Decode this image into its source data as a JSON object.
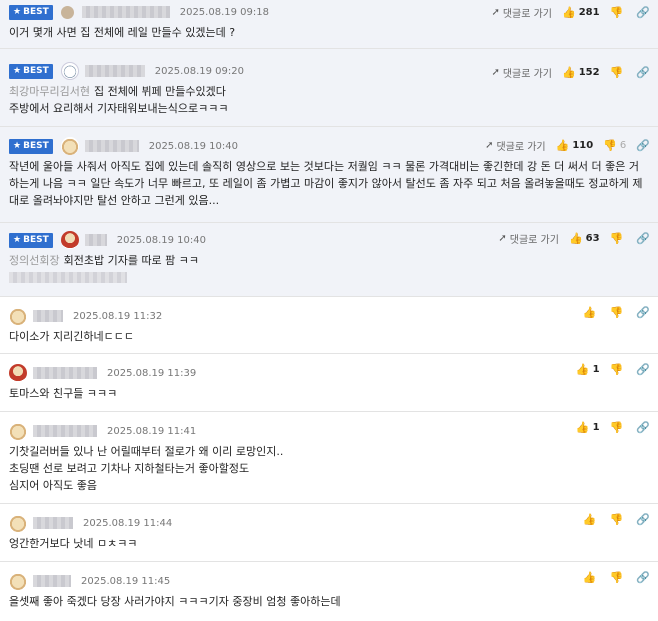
{
  "best_label": "BEST",
  "reply_label": "댓글로 가기",
  "comments": [
    {
      "date": "2025.08.19 09:18",
      "likes": "281",
      "dislikes": "",
      "mention": "",
      "text": "이거 몇개 사면 집 전체에 레일 만들수 있겠는데 ?"
    },
    {
      "date": "2025.08.19 09:20",
      "likes": "152",
      "dislikes": "",
      "mention": "최강마무리김서현",
      "text": "집 전체에 뷔페 만들수있겠다\n주방에서 요리해서 기자태워보내는식으로ㅋㅋㅋ"
    },
    {
      "date": "2025.08.19 10:40",
      "likes": "110",
      "dislikes": "6",
      "mention": "",
      "text": "작년에 울아들 사줘서 아직도 집에 있는데 솔직히 영상으로 보는 것보다는 저퀄임 ㅋㅋ 물론 가격대비는 좋긴한데 강 돈 더 써서 더 좋은 거 하는게 나음 ㅋㅋ 일단 속도가 너무 빠르고, 또 레일이 좀 가볍고 마감이 좋지가 않아서 탈선도 좀 자주 되고 처음 올려놓을때도 정교하게 제대로 올려놔야지만 탈선 안하고 그런게 있음..."
    },
    {
      "date": "2025.08.19 10:40",
      "likes": "63",
      "dislikes": "",
      "mention": "정의선회장",
      "text": "회전초밥 기자를 따로 팜 ㅋㅋ"
    },
    {
      "date": "2025.08.19 11:32",
      "likes": "",
      "dislikes": "",
      "mention": "",
      "text": "다이소가 지리긴하네ㄷㄷㄷ"
    },
    {
      "date": "2025.08.19 11:39",
      "likes": "1",
      "dislikes": "",
      "mention": "",
      "text": "토마스와 친구들 ㅋㅋㅋ"
    },
    {
      "date": "2025.08.19 11:41",
      "likes": "1",
      "dislikes": "",
      "mention": "",
      "text": "기찻길러버들 있나 난 어릴때부터 절로가 왜 이리 로망인지..\n초딩땐 선로 보려고 기차나 지하철타는거 좋아할정도\n심지어 아직도 좋음"
    },
    {
      "date": "2025.08.19 11:44",
      "likes": "",
      "dislikes": "",
      "mention": "",
      "text": "엉간한거보다 낫네 ㅁㅊㅋㅋ"
    },
    {
      "date": "2025.08.19 11:45",
      "likes": "",
      "dislikes": "",
      "mention": "",
      "text": "을셋째 좋아 죽겠다 당장 사러가야지 ㅋㅋㅋ기자 중장비 엄청 좋아하는데"
    }
  ]
}
